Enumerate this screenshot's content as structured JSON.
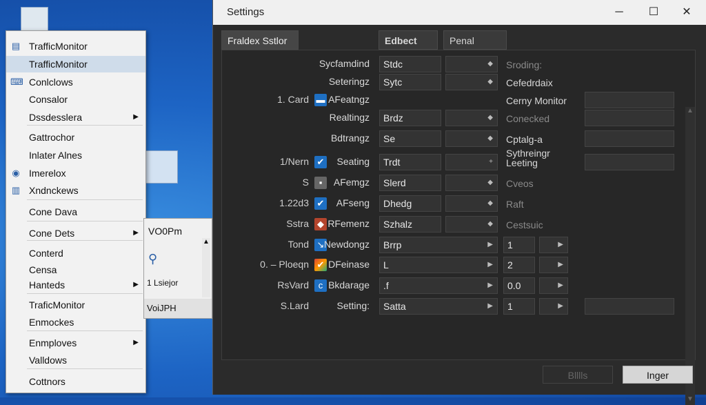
{
  "desktop": {
    "overlay_label": "VO0Pm",
    "shortcut_label": "VoiJPH"
  },
  "context_menu": {
    "items": [
      {
        "label": "TrafficMonitor",
        "icon": "monitor-icon"
      },
      {
        "label": "TrafficMonitor",
        "icon": "",
        "highlight": true
      },
      {
        "label": "Conlclows",
        "icon": "keyboard-icon"
      },
      {
        "label": "Consalor",
        "icon": ""
      },
      {
        "label": "Dssdesslera",
        "icon": "",
        "submenu": true
      },
      {
        "label": "Gattrochor",
        "icon": ""
      },
      {
        "label": "Inlater Alnes",
        "icon": ""
      },
      {
        "label": "Imerelox",
        "icon": "globe-icon"
      },
      {
        "label": "Xndnckews",
        "icon": "chart-icon"
      },
      {
        "label": "Cone Dava",
        "icon": ""
      },
      {
        "label": "Cone Dets",
        "icon": "",
        "submenu": true
      },
      {
        "label": "Conterd",
        "icon": ""
      },
      {
        "label": "Censa",
        "icon": ""
      },
      {
        "label": "Hanteds",
        "icon": "",
        "submenu": true
      },
      {
        "label": "TraficMonitor",
        "icon": ""
      },
      {
        "label": "Enmockes",
        "icon": ""
      },
      {
        "label": "Enmploves",
        "icon": "",
        "submenu": true
      },
      {
        "label": "Valldows",
        "icon": ""
      },
      {
        "label": "Cottnors",
        "icon": ""
      }
    ]
  },
  "popup2": {
    "header": "VO0Pm",
    "middle": "1 Lsiejor",
    "footer": "VoiJPH"
  },
  "window": {
    "title": "Settings",
    "tabs": [
      "Fraldex Sstlor",
      "Edbect",
      "Penal"
    ],
    "rows": [
      {
        "label": "Sycfamdind",
        "field": "Stdc",
        "right1": "Sroding:",
        "right1_dim": true
      },
      {
        "label": "Seteringz",
        "field": "Sytc",
        "right1": "Cefedrdaix"
      },
      {
        "prefix": "1. Card",
        "label": "AFeatngz",
        "check": "blue-bar",
        "right1": "Cerny Monitor"
      },
      {
        "label": "Realtingz",
        "field": "Brdz",
        "right1": "Conecked",
        "right1_dim": true
      },
      {
        "label": "Bdtrangz",
        "field": "Se",
        "right1": "Cptalg-a Sythreingr"
      },
      {
        "prefix": "1/Nern",
        "label": "Seating",
        "check": "checked",
        "field": "Trdt",
        "right1": "Leeting"
      },
      {
        "prefix": "S",
        "label": "AFemgz",
        "check": "square-icon",
        "field": "Slerd",
        "right1": "Cveos",
        "right1_dim": true
      },
      {
        "prefix": "1.22d3",
        "label": "AFseng",
        "check": "checked",
        "field": "Dhedg",
        "right1": "Raft",
        "right1_dim": true
      },
      {
        "prefix": "Sstra",
        "label": "RFemenz",
        "check": "diamond-icon",
        "field": "Szhalz",
        "right1": "Cestsuic",
        "right1_dim": true
      },
      {
        "prefix": "Tond",
        "label": "Newdongz",
        "check": "blue-arrow",
        "field": "Brrp",
        "num": "1"
      },
      {
        "prefix": "0. ‒ Ploeqn",
        "label": "DFeinase",
        "check": "multicolor-check",
        "field": "L",
        "num": "2"
      },
      {
        "prefix": "RsVard",
        "label": "Bkdarage",
        "check": "blue-c",
        "field": ".f",
        "num": "0.0"
      },
      {
        "prefix": "S.Lard",
        "label": "Setting:",
        "field": "Satta",
        "num": "1"
      }
    ],
    "footer": {
      "apply_label": "Blllls",
      "ok_label": "Inger"
    }
  }
}
